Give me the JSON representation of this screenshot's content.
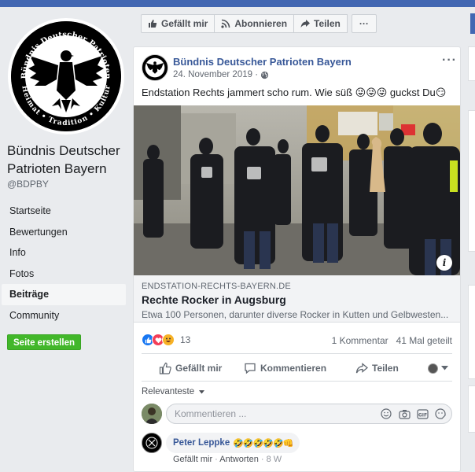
{
  "colors": {
    "brand": "#4267b2",
    "link": "#385898",
    "green": "#42b72a",
    "bg": "#e9ebee"
  },
  "page": {
    "name": "Bündnis Deutscher Patrioten Bayern",
    "handle": "@BDPBY",
    "logo_text_top": "Bündnis Deutscher Patrioten",
    "logo_text_bottom": "Heimat • Tradition • Kultur"
  },
  "sidebar": {
    "items": [
      {
        "label": "Startseite",
        "active": false
      },
      {
        "label": "Bewertungen",
        "active": false
      },
      {
        "label": "Info",
        "active": false
      },
      {
        "label": "Fotos",
        "active": false
      },
      {
        "label": "Beiträge",
        "active": true
      },
      {
        "label": "Community",
        "active": false
      }
    ],
    "create_button": "Seite erstellen"
  },
  "actionbar": {
    "like": "Gefällt mir",
    "subscribe": "Abonnieren",
    "share": "Teilen",
    "more": "···"
  },
  "post": {
    "author": "Bündnis Deutscher Patrioten Bayern",
    "date": "24. November 2019 ·",
    "text": "Endstation Rechts jammert scho rum. Wie süß 😜😜😜 guckst Du😏",
    "link": {
      "domain": "ENDSTATION-RECHTS-BAYERN.DE",
      "title": "Rechte Rocker in Augsburg",
      "description": "Etwa 100 Personen, darunter diverse Rocker in Kutten und Gelbwesten..."
    },
    "reactions_count": "13",
    "comments_count": "1 Kommentar",
    "shares_count": "41 Mal geteilt",
    "actions": {
      "like": "Gefällt mir",
      "comment": "Kommentieren",
      "share": "Teilen"
    },
    "sort": "Relevanteste",
    "comment_placeholder": "Kommentieren ...",
    "comment": {
      "author": "Peter Leppke",
      "emojis": "🤣🤣🤣🤣🤣👊",
      "like": "Gefällt mir",
      "reply": "Antworten",
      "age": "8 W"
    }
  }
}
